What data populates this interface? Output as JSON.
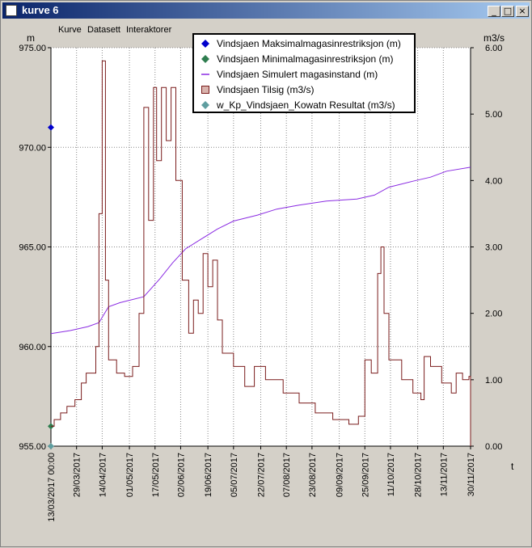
{
  "window": {
    "title": "kurve 6"
  },
  "window_buttons": {
    "minimize": "_",
    "maximize": "□",
    "close": "×"
  },
  "menu": {
    "items": [
      "Kurve",
      "Datasett",
      "Interaktorer"
    ]
  },
  "colors": {
    "tilsig": "#7a1c1c",
    "magasin": "#8a2be2",
    "maks": "#0000cc",
    "min": "#2e7d4f",
    "resultat": "#5f9ea0"
  },
  "chart_data": {
    "type": "line",
    "y_left": {
      "unit": "m",
      "ylim": [
        955,
        975
      ],
      "ticks": [
        "955.00",
        "960.00",
        "965.00",
        "970.00",
        "975.00"
      ]
    },
    "y_right": {
      "unit": "m3/s",
      "ylim": [
        0,
        6
      ],
      "ticks": [
        "0.00",
        "1.00",
        "2.00",
        "3.00",
        "4.00",
        "5.00",
        "6.00"
      ]
    },
    "x": {
      "unit": "t",
      "range": [
        "2017-03-13",
        "2017-11-30"
      ],
      "tick_labels": [
        "13/03/2017 00:00",
        "29/03/2017",
        "14/04/2017",
        "01/05/2017",
        "17/05/2017",
        "02/06/2017",
        "19/06/2017",
        "05/07/2017",
        "22/07/2017",
        "07/08/2017",
        "23/08/2017",
        "09/09/2017",
        "25/09/2017",
        "11/10/2017",
        "28/10/2017",
        "13/11/2017",
        "30/11/2017"
      ]
    },
    "grid": true,
    "legend_position": "top-center",
    "series": [
      {
        "name": "Vindsjaen Maksimalmagasinrestriksjon (m)",
        "axis": "left",
        "style": "diamond",
        "color": "#0000cc",
        "points": [
          [
            "2017-03-13",
            971.0
          ]
        ]
      },
      {
        "name": "Vindsjaen Minimalmagasinrestriksjon (m)",
        "axis": "left",
        "style": "diamond",
        "color": "#2e7d4f",
        "points": [
          [
            "2017-03-13",
            956.0
          ]
        ]
      },
      {
        "name": "Vindsjaen Simulert magasinstand (m)",
        "axis": "left",
        "style": "line",
        "color": "#8a2be2",
        "points": [
          [
            "2017-03-13",
            960.65
          ],
          [
            "2017-03-25",
            960.8
          ],
          [
            "2017-04-05",
            961.0
          ],
          [
            "2017-04-12",
            961.2
          ],
          [
            "2017-04-18",
            962.0
          ],
          [
            "2017-04-25",
            962.2
          ],
          [
            "2017-05-10",
            962.5
          ],
          [
            "2017-05-20",
            963.4
          ],
          [
            "2017-05-28",
            964.2
          ],
          [
            "2017-06-05",
            964.9
          ],
          [
            "2017-06-15",
            965.4
          ],
          [
            "2017-06-25",
            965.9
          ],
          [
            "2017-07-05",
            966.3
          ],
          [
            "2017-07-20",
            966.6
          ],
          [
            "2017-08-01",
            966.9
          ],
          [
            "2017-08-15",
            967.1
          ],
          [
            "2017-09-01",
            967.3
          ],
          [
            "2017-09-20",
            967.4
          ],
          [
            "2017-10-01",
            967.6
          ],
          [
            "2017-10-10",
            968.0
          ],
          [
            "2017-10-25",
            968.3
          ],
          [
            "2017-11-05",
            968.5
          ],
          [
            "2017-11-15",
            968.8
          ],
          [
            "2017-11-30",
            969.0
          ]
        ]
      },
      {
        "name": "Vindsjaen Tilsig (m3/s)",
        "axis": "right",
        "style": "step",
        "color": "#7a1c1c",
        "points": [
          [
            "2017-03-13",
            0.3
          ],
          [
            "2017-03-15",
            0.4
          ],
          [
            "2017-03-19",
            0.5
          ],
          [
            "2017-03-23",
            0.6
          ],
          [
            "2017-03-28",
            0.7
          ],
          [
            "2017-04-01",
            0.95
          ],
          [
            "2017-04-04",
            1.1
          ],
          [
            "2017-04-08",
            1.1
          ],
          [
            "2017-04-10",
            1.5
          ],
          [
            "2017-04-12",
            3.5
          ],
          [
            "2017-04-14",
            5.8
          ],
          [
            "2017-04-16",
            2.5
          ],
          [
            "2017-04-18",
            1.3
          ],
          [
            "2017-04-23",
            1.1
          ],
          [
            "2017-04-28",
            1.05
          ],
          [
            "2017-05-03",
            1.2
          ],
          [
            "2017-05-07",
            2.0
          ],
          [
            "2017-05-10",
            5.1
          ],
          [
            "2017-05-13",
            3.4
          ],
          [
            "2017-05-16",
            5.4
          ],
          [
            "2017-05-18",
            4.3
          ],
          [
            "2017-05-21",
            5.4
          ],
          [
            "2017-05-24",
            4.6
          ],
          [
            "2017-05-27",
            5.4
          ],
          [
            "2017-05-30",
            4.0
          ],
          [
            "2017-06-03",
            2.5
          ],
          [
            "2017-06-07",
            1.7
          ],
          [
            "2017-06-10",
            2.2
          ],
          [
            "2017-06-13",
            2.0
          ],
          [
            "2017-06-16",
            2.9
          ],
          [
            "2017-06-19",
            2.4
          ],
          [
            "2017-06-22",
            2.8
          ],
          [
            "2017-06-25",
            1.9
          ],
          [
            "2017-06-28",
            1.4
          ],
          [
            "2017-07-05",
            1.2
          ],
          [
            "2017-07-12",
            0.9
          ],
          [
            "2017-07-18",
            1.2
          ],
          [
            "2017-07-25",
            1.0
          ],
          [
            "2017-08-05",
            0.8
          ],
          [
            "2017-08-15",
            0.65
          ],
          [
            "2017-08-25",
            0.5
          ],
          [
            "2017-09-05",
            0.4
          ],
          [
            "2017-09-15",
            0.33
          ],
          [
            "2017-09-21",
            0.45
          ],
          [
            "2017-09-25",
            1.3
          ],
          [
            "2017-09-29",
            1.1
          ],
          [
            "2017-10-03",
            2.6
          ],
          [
            "2017-10-05",
            3.0
          ],
          [
            "2017-10-07",
            2.0
          ],
          [
            "2017-10-10",
            1.3
          ],
          [
            "2017-10-18",
            1.0
          ],
          [
            "2017-10-25",
            0.8
          ],
          [
            "2017-10-30",
            0.7
          ],
          [
            "2017-11-01",
            1.35
          ],
          [
            "2017-11-05",
            1.2
          ],
          [
            "2017-11-12",
            0.95
          ],
          [
            "2017-11-18",
            0.8
          ],
          [
            "2017-11-21",
            1.1
          ],
          [
            "2017-11-25",
            1.0
          ],
          [
            "2017-11-29",
            1.05
          ],
          [
            "2017-11-30",
            0.0
          ]
        ]
      },
      {
        "name": "w_Kp_Vindsjaen_Kowatn Resultat (m3/s)",
        "axis": "right",
        "style": "diamond",
        "color": "#5f9ea0",
        "points": [
          [
            "2017-03-13",
            0.0
          ]
        ]
      }
    ]
  }
}
